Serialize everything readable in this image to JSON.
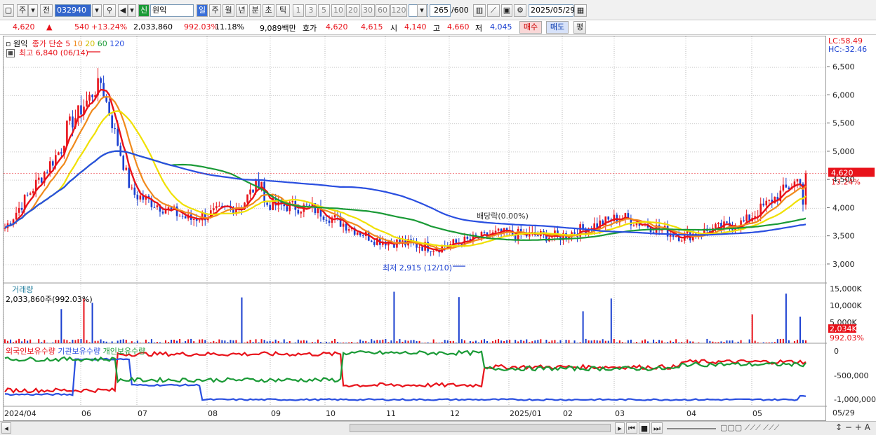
{
  "toolbar": {
    "tab1": "주",
    "tab2": "전",
    "code": "032940",
    "badge": "신",
    "name": "원익",
    "periods": [
      "일",
      "주",
      "월",
      "년",
      "분",
      "초",
      "틱"
    ],
    "intervals": [
      "1",
      "3",
      "5",
      "10",
      "20",
      "30",
      "60",
      "120"
    ],
    "count": "265",
    "count_total": "/600",
    "date": "2025/05/29"
  },
  "quote": {
    "price": "4,620",
    "arrow": "▲",
    "change": "540",
    "change_pct": "+13.24%",
    "volume": "2,033,860",
    "vol_pct": "992.03%",
    "turnover_pct": "11.18%",
    "amount": "9,089백만",
    "hoga_label": "호가",
    "hoga_ask": "4,620",
    "hoga_bid": "4,615",
    "open_label": "시",
    "open": "4,140",
    "high_label": "고",
    "high": "4,660",
    "low_label": "저",
    "low": "4,045",
    "buy": "매수",
    "sell": "매도",
    "eval": "평"
  },
  "legend": {
    "name": "원익",
    "ma_label": "종가 단순",
    "ma": [
      "5",
      "10",
      "20",
      "60",
      "120"
    ],
    "ma_colors": [
      "#e8121a",
      "#f08a1c",
      "#f0e000",
      "#1a9a36",
      "#2a4fe0"
    ]
  },
  "annotations": {
    "high": "최고 6,840 (06/14)",
    "low": "최저 2,915 (12/10)",
    "dividend": "배당락(0.00%)"
  },
  "lc": "LC:58.49",
  "hc": "HC:-32.46",
  "price_axis": [
    "6,500",
    "6,000",
    "5,500",
    "5,000",
    "4,500",
    "4,000",
    "3,500",
    "3,000"
  ],
  "last_price_tag": "4,620",
  "last_pct_tag": "13.24%",
  "volume_panel": {
    "title": "거래량",
    "value": "2,033,860주(992.03%)",
    "axis": [
      "15,000K",
      "10,000K",
      "5,000K"
    ],
    "tag1": "2,034K",
    "tag2": "992.03%"
  },
  "holding_panel": {
    "series": [
      "외국인보유수량",
      "기관보유수량",
      "개인보유수량"
    ],
    "colors": [
      "#e8121a",
      "#2a4fe0",
      "#1a9a36"
    ],
    "axis": [
      "0",
      "-500,000",
      "-1,000,000"
    ]
  },
  "x_axis": [
    "2024/04",
    "06",
    "07",
    "08",
    "09",
    "10",
    "11",
    "12",
    "2025/01",
    "02",
    "03",
    "04",
    "05"
  ],
  "x_right": "05/29",
  "chart_data": {
    "type": "candlestick",
    "ylim": [
      2800,
      6800
    ],
    "ma_windows": [
      5,
      10,
      20,
      60,
      120
    ],
    "monthly_close_approx": [
      {
        "m": "2024/04",
        "v": 3650
      },
      {
        "m": "06",
        "v": 5200
      },
      {
        "m": "07",
        "v": 4300
      },
      {
        "m": "08",
        "v": 3800
      },
      {
        "m": "09",
        "v": 4100
      },
      {
        "m": "10",
        "v": 4000
      },
      {
        "m": "11",
        "v": 3450
      },
      {
        "m": "12",
        "v": 3300
      },
      {
        "m": "2025/01",
        "v": 3550
      },
      {
        "m": "02",
        "v": 3500
      },
      {
        "m": "03",
        "v": 3850
      },
      {
        "m": "04",
        "v": 3500
      },
      {
        "m": "05",
        "v": 3750
      },
      {
        "m": "05/29",
        "v": 4620
      }
    ],
    "high": {
      "v": 6840,
      "date": "06/14"
    },
    "low": {
      "v": 2915,
      "date": "12/10"
    },
    "last": 4620
  }
}
